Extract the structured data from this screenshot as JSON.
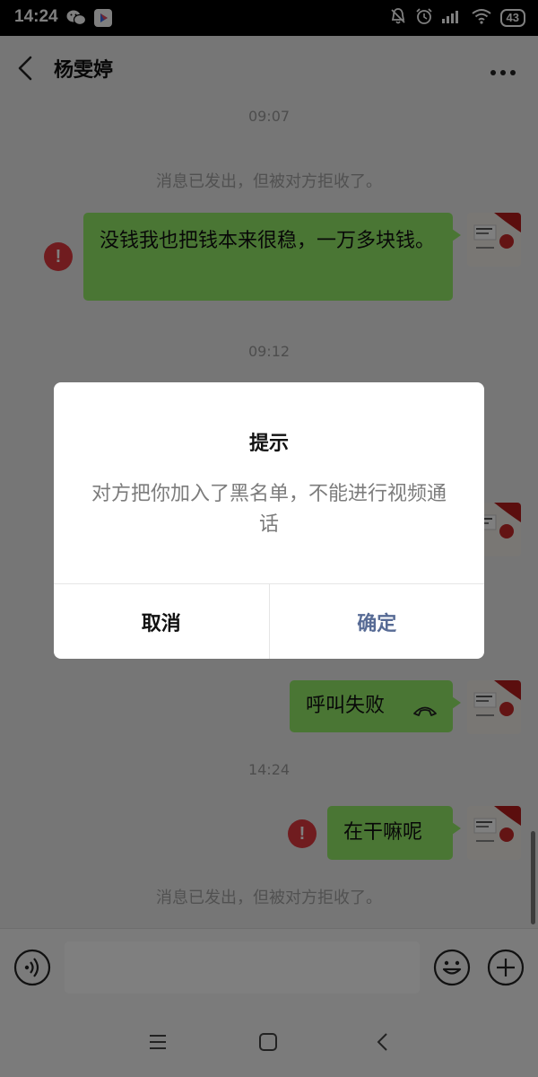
{
  "status_bar": {
    "time": "14:24",
    "app_icons": [
      "wechat-icon",
      "video-app-icon"
    ],
    "right_icons": [
      "mute-bell-icon",
      "alarm-icon",
      "signal-icon",
      "wifi-icon"
    ],
    "battery": "43"
  },
  "header": {
    "back_icon": "chevron-left-icon",
    "title": "杨雯婷",
    "more_icon": "more-dots-icon"
  },
  "messages": {
    "time_1": "09:07",
    "system_1": "消息已发出，但被对方拒收了。",
    "bubble_1": "没钱我也把钱本来很稳，一万多块钱。",
    "time_2": "09:12",
    "call_fail": "呼叫失败",
    "time_3": "14:24",
    "bubble_3": "在干嘛呢",
    "system_2": "消息已发出，但被对方拒收了。",
    "error_mark": "!"
  },
  "dialog": {
    "title": "提示",
    "message": "对方把你加入了黑名单，不能进行视频通话",
    "cancel_label": "取消",
    "ok_label": "确定"
  },
  "input_bar": {
    "voice_icon": "voice-icon",
    "placeholder": "",
    "emoji_icon": "emoji-icon",
    "plus_icon": "plus-icon"
  },
  "nav_bar": {
    "icons": [
      "menu-icon",
      "home-icon",
      "back-icon"
    ]
  },
  "colors": {
    "bubble_green": "#95ec69",
    "error_red": "#e0393e",
    "link_blue": "#576b95",
    "background": "#ededed"
  }
}
